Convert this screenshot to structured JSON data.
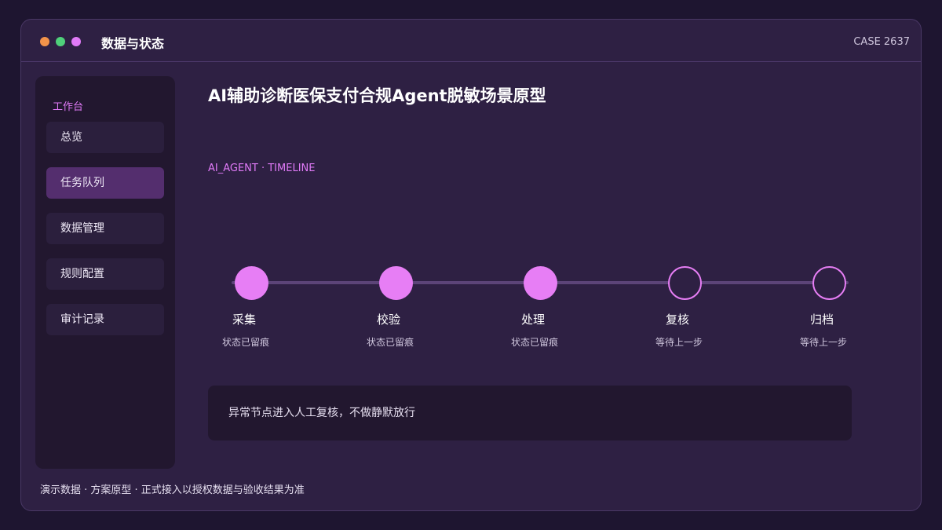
{
  "window": {
    "title": "数据与状态",
    "case_id": "CASE 2637",
    "traffic_lights": [
      "#f3934a",
      "#4fd07a",
      "#e07af7"
    ]
  },
  "sidebar": {
    "section_label": "工作台",
    "items": [
      {
        "label": "总览",
        "active": false
      },
      {
        "label": "任务队列",
        "active": true
      },
      {
        "label": "数据管理",
        "active": false
      },
      {
        "label": "规则配置",
        "active": false
      },
      {
        "label": "审计记录",
        "active": false
      }
    ]
  },
  "main": {
    "title": "AI辅助诊断医保支付合规Agent脱敏场景原型",
    "subtitle": "AI_AGENT · TIMELINE",
    "timeline": [
      {
        "label": "采集",
        "status": "状态已留痕",
        "completed": true
      },
      {
        "label": "校验",
        "status": "状态已留痕",
        "completed": true
      },
      {
        "label": "处理",
        "status": "状态已留痕",
        "completed": true
      },
      {
        "label": "复核",
        "status": "等待上一步",
        "completed": false
      },
      {
        "label": "归档",
        "status": "等待上一步",
        "completed": false
      }
    ],
    "notice": "异常节点进入人工复核，不做静默放行"
  },
  "footer": "演示数据 · 方案原型 · 正式接入以授权数据与验收结果为准",
  "colors": {
    "accent": "#e77ef5",
    "background": "#1e1530",
    "window": "#2e2043",
    "panel": "#22172f"
  }
}
